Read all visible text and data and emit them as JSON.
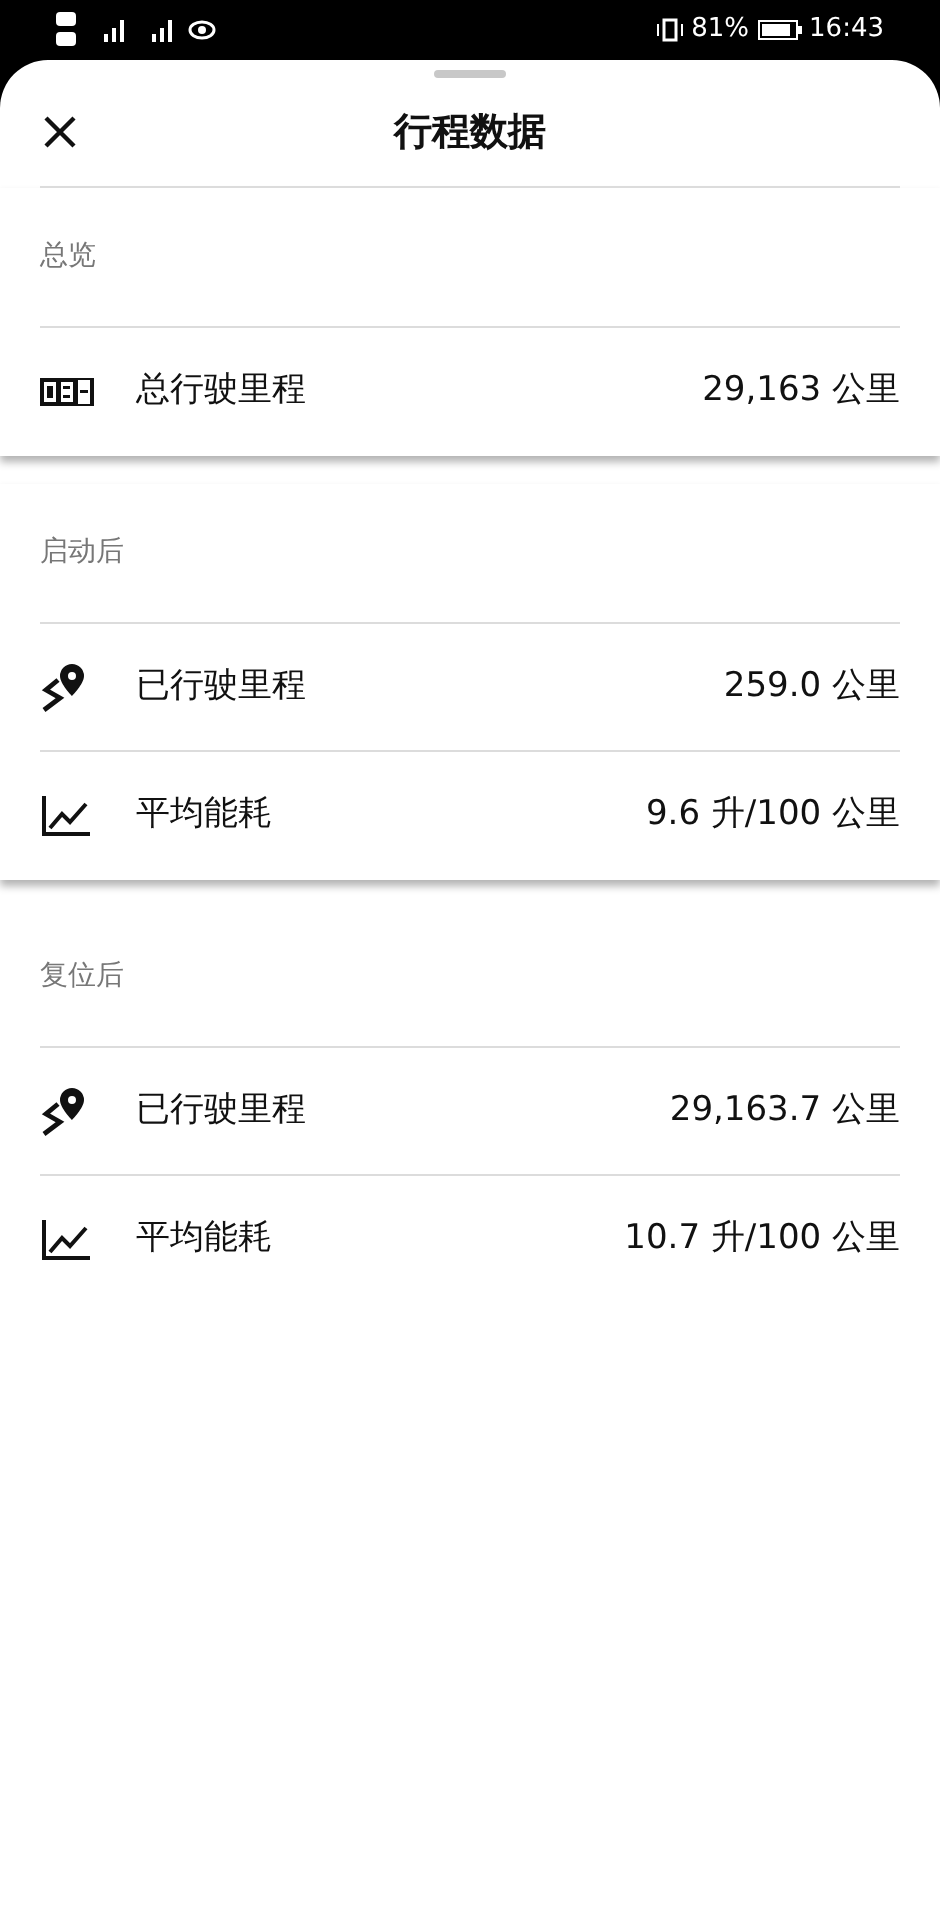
{
  "status_bar": {
    "battery": "81%",
    "time": "16:43"
  },
  "header": {
    "title": "行程数据"
  },
  "sections": [
    {
      "title": "总览",
      "rows": [
        {
          "kind": "odometer",
          "label": "总行驶里程",
          "value": "29,163 公里"
        }
      ]
    },
    {
      "title": "启动后",
      "rows": [
        {
          "kind": "route",
          "label": "已行驶里程",
          "value": "259.0 公里"
        },
        {
          "kind": "chart",
          "label": "平均能耗",
          "value": "9.6 升/100 公里"
        }
      ]
    },
    {
      "title": "复位后",
      "rows": [
        {
          "kind": "route",
          "label": "已行驶里程",
          "value": "29,163.7 公里"
        },
        {
          "kind": "chart",
          "label": "平均能耗",
          "value": "10.7 升/100 公里"
        }
      ]
    }
  ]
}
